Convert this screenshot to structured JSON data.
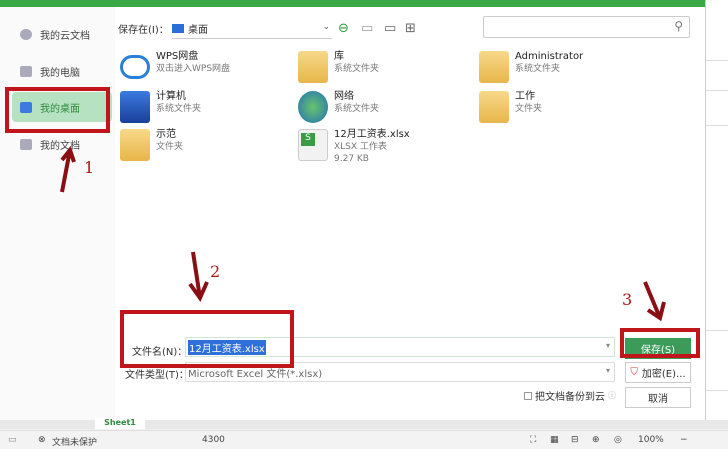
{
  "sidebar": {
    "items": [
      {
        "label": "我的云文档"
      },
      {
        "label": "我的电脑"
      },
      {
        "label": "我的桌面"
      },
      {
        "label": "我的文档"
      }
    ]
  },
  "toolbar": {
    "save_in_label": "保存在(I)：",
    "location": "桌面"
  },
  "files": [
    {
      "name": "WPS网盘",
      "sub": "双击进入WPS网盘"
    },
    {
      "name": "库",
      "sub": "系统文件夹"
    },
    {
      "name": "Administrator",
      "sub": "系统文件夹"
    },
    {
      "name": "计算机",
      "sub": "系统文件夹"
    },
    {
      "name": "网络",
      "sub": "系统文件夹"
    },
    {
      "name": "工作",
      "sub": "文件夹"
    },
    {
      "name": "示范",
      "sub": "文件夹"
    },
    {
      "name": "12月工资表.xlsx",
      "sub": "XLSX 工作表",
      "size": "9.27 KB"
    }
  ],
  "form": {
    "filename_label": "文件名(N)：",
    "filename_value": "12月工资表.xlsx",
    "filetype_label": "文件类型(T)：",
    "filetype_value": "Microsoft Excel 文件(*.xlsx)",
    "backup_label": "把文档备份到云"
  },
  "buttons": {
    "save": "保存(S)",
    "encrypt": "加密(E)...",
    "cancel": "取消"
  },
  "annotations": [
    "1",
    "2",
    "3"
  ],
  "sheet_tab": "Sheet1",
  "status": {
    "protect": "文档未保护",
    "value": "4300",
    "zoom": "100%"
  }
}
